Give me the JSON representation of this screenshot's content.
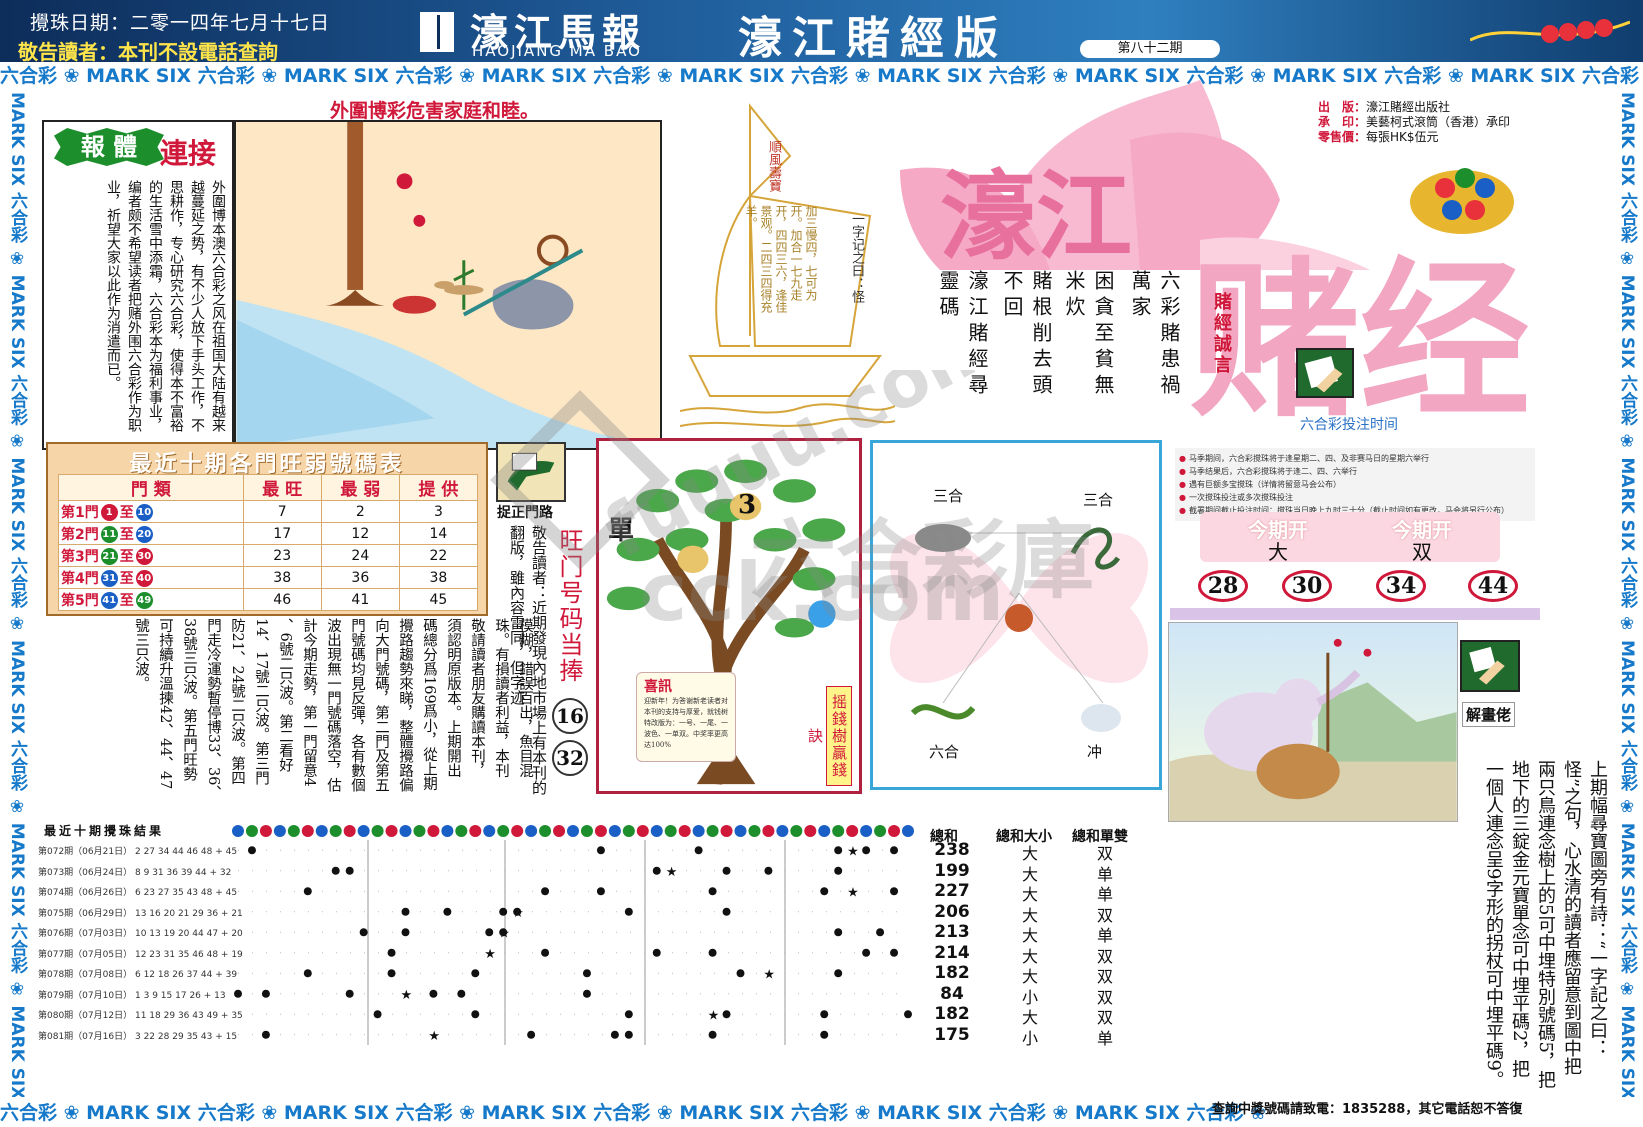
{
  "header": {
    "date": "攪珠日期：二零一四年七月十七日",
    "warning": "敬告讀者：本刊不設電話查詢",
    "masthead": "濠江馬報",
    "masthead_en": "HAOJIANG MA BAO",
    "edition": "濠江賭經版",
    "issue": "第八十二期"
  },
  "strip": {
    "unit": "六合彩 ❀ MARK SIX ",
    "unit_vertical": "MARK SIX 六合彩 ❀ "
  },
  "harm_title": "外圍博彩危害家庭和睦。",
  "body_section": {
    "tag": "報 體",
    "tag2": "連接",
    "text": "外圍博本澳六合彩之风在祖国大陆有越来越蔓延之势，有不少人放下手头工作，不思耕作，专心研究六合彩，使得本不富裕的生活雪中添霜，六合彩本为福利事业，编者颇不希望读者把赌外围六合彩作为职业，祈望大家以此作为消遣而已。"
  },
  "boat": {
    "flag": "順風壽寶",
    "verse": "一字记之曰：怪",
    "clues": "加三慢四，七可为开。加合一七九走开，四四三六，逢佳景观。二四三四得充羊。"
  },
  "poem": [
    "六彩賭患禍萬家",
    "困貪至貧無米炊",
    "賭根削去頭不回",
    "濠江賭經尋靈碼"
  ],
  "logo": {
    "line1": "濠江",
    "line2": "赌经",
    "motto": "賭經誠言"
  },
  "pub_info": [
    {
      "label": "出　版：",
      "value": "濠江賭經出版社"
    },
    {
      "label": "承　印：",
      "value": "美藝柯式滾筒（香港）承印"
    },
    {
      "label": "零售價：",
      "value": "每張HK$伍元"
    }
  ],
  "bet_time": {
    "title": "六合彩投注时间",
    "rules": [
      "马季期间，六合彩搅珠将于逢星期二、四、及非赛马日的星期六举行",
      "马季结果后，六合彩搅珠将于逢二、四、六举行",
      "遇有巨额多宝搅珠（详情将留意马会公布）",
      "一次搅珠投注或多次搅珠投注",
      "截署期间截止投注时间：搅珠当日晚上九时三十分（截止时间如有更改，马会将另行公布）"
    ]
  },
  "current_draw": {
    "label1": "今期开",
    "value1": "大",
    "label2": "今期开",
    "value2": "双",
    "numbers": [
      "28",
      "30",
      "34",
      "44"
    ]
  },
  "ten_table": {
    "title": "最近十期各門旺弱號碼表",
    "headers": [
      "門 類",
      "最 旺",
      "最 弱",
      "提 供"
    ],
    "rows": [
      {
        "door": "第1門",
        "from": "1",
        "to": "10",
        "from_color": "#d0183a",
        "to_color": "#1a5fc6",
        "hot": "7",
        "cold": "2",
        "offer": "3"
      },
      {
        "door": "第2門",
        "from": "11",
        "to": "20",
        "from_color": "#1c8f2c",
        "to_color": "#1a5fc6",
        "hot": "17",
        "cold": "12",
        "offer": "14"
      },
      {
        "door": "第3門",
        "from": "21",
        "to": "30",
        "from_color": "#1c8f2c",
        "to_color": "#d0183a",
        "hot": "23",
        "cold": "24",
        "offer": "22"
      },
      {
        "door": "第4門",
        "from": "31",
        "to": "40",
        "from_color": "#1a5fc6",
        "to_color": "#d0183a",
        "hot": "38",
        "cold": "36",
        "offer": "38"
      },
      {
        "door": "第5門",
        "from": "41",
        "to": "49",
        "from_color": "#1a5fc6",
        "to_color": "#1c8f2c",
        "hot": "46",
        "cold": "41",
        "offer": "45"
      }
    ],
    "to_word": "至"
  },
  "notice": {
    "catch_label": "捉正門路",
    "right_col": "敬告讀者：近期發現內地市場上有本刊的翻版，雖內容雷同，但字迹",
    "columns": [
      "模糊，錯誤百出，魚目混",
      "珠。有損讀者利益，本刊",
      "敬請讀者朋友購讀本刊，",
      "須認明原版本。上期開出",
      "碼總分爲169爲小，從上期",
      "攪路趨勢來睇，整體攪路偏",
      "向大門號碼，第二門及第五",
      "門號碼均見反彈，各有數個",
      "波出現無一門號碼落空，估",
      "計今期走勢，第一門留意4",
      "、6號二只波。第二看好",
      "14、17號二只波。第三門",
      "防21、24號二只波。第四",
      "門走冷運勢暫停博33、36、",
      "38號三只波。第五門旺勢",
      "可持續升溫揀42、44、47",
      "號三只波。"
    ],
    "hot_title": "旺门号码当捧",
    "hot_numbers": [
      "16",
      "32"
    ]
  },
  "tree": {
    "single": "單",
    "number": "3",
    "luck_title": "喜訊",
    "luck_text": "迎新年！为答谢新老读者对本刊的支持与厚爱，就钱树特改版为：一号、一尾、一波色、一单双。中奖率更高达100%",
    "side": "摇錢樹贏錢訣"
  },
  "zodiac": {
    "labels": [
      "三合",
      "三合",
      "六合",
      "冲"
    ]
  },
  "explain": {
    "label": "解畫佬",
    "text": "上期幅尋寶圖旁有詩：“一字記之曰：怪”之句，心水清的讀者應留意到圖中把兩只鳥連念樹上的5可中埋特別號碼5，把地下的三錠金元寶單念可中埋平碼2，把一個人連念呈9字形的拐杖可中埋平碼9。"
  },
  "results": {
    "title": "最近十期攪珠結果",
    "col_sum": "總和",
    "col_big": "總和大小",
    "col_oe": "總和單雙",
    "rows": [
      {
        "label": "第072期（06月21日）",
        "balls": [
          2,
          27,
          34,
          44,
          46,
          48
        ],
        "special": "45",
        "sum": "238",
        "big": "大",
        "oe": "双"
      },
      {
        "label": "第073期（06月24日）",
        "balls": [
          8,
          9,
          31,
          36,
          39,
          44
        ],
        "special": "32",
        "sum": "199",
        "big": "大",
        "oe": "单"
      },
      {
        "label": "第074期（06月26日）",
        "balls": [
          6,
          23,
          27,
          35,
          43,
          48
        ],
        "special": "45",
        "sum": "227",
        "big": "大",
        "oe": "单"
      },
      {
        "label": "第075期（06月29日）",
        "balls": [
          13,
          16,
          20,
          21,
          29,
          36
        ],
        "special": "21",
        "sum": "206",
        "big": "大",
        "oe": "双"
      },
      {
        "label": "第076期（07月03日）",
        "balls": [
          10,
          13,
          19,
          20,
          44,
          47
        ],
        "special": "20",
        "sum": "213",
        "big": "大",
        "oe": "单"
      },
      {
        "label": "第077期（07月05日）",
        "balls": [
          12,
          23,
          31,
          35,
          46,
          48
        ],
        "special": "19",
        "sum": "214",
        "big": "大",
        "oe": "双"
      },
      {
        "label": "第078期（07月08日）",
        "balls": [
          6,
          12,
          18,
          26,
          37,
          44
        ],
        "special": "39",
        "sum": "182",
        "big": "大",
        "oe": "双"
      },
      {
        "label": "第079期（07月10日）",
        "balls": [
          1,
          3,
          9,
          15,
          17,
          26
        ],
        "special": "13",
        "sum": "84",
        "big": "小",
        "oe": "双"
      },
      {
        "label": "第080期（07月12日）",
        "balls": [
          11,
          18,
          29,
          36,
          43,
          49
        ],
        "special": "35",
        "sum": "182",
        "big": "大",
        "oe": "双"
      },
      {
        "label": "第081期（07月16日）",
        "balls": [
          3,
          22,
          28,
          29,
          35,
          43
        ],
        "special": "15",
        "sum": "175",
        "big": "小",
        "oe": "单"
      }
    ]
  },
  "footer": "查詢中獎號碼請致電：1835288，其它電話恕不答復"
}
